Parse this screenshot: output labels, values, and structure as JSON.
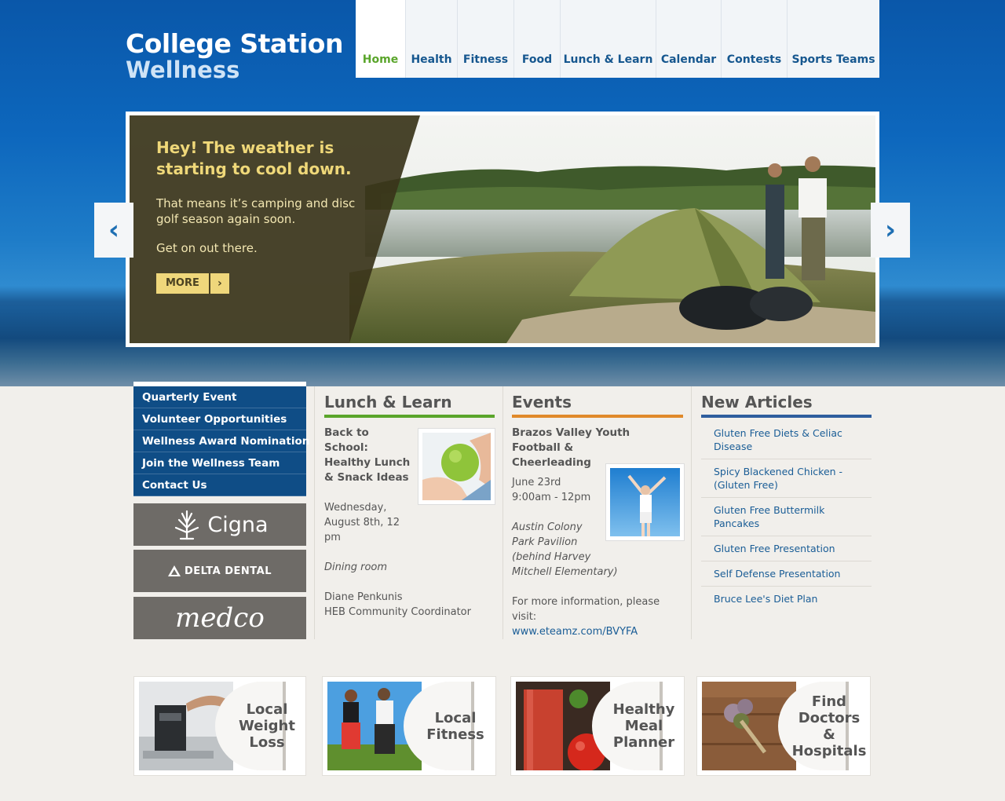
{
  "brand": {
    "line1": "College Station",
    "line2": "Wellness"
  },
  "nav": [
    {
      "label": "Home",
      "active": true
    },
    {
      "label": "Health"
    },
    {
      "label": "Fitness"
    },
    {
      "label": "Food"
    },
    {
      "label": "Lunch & Learn"
    },
    {
      "label": "Calendar"
    },
    {
      "label": "Contests"
    },
    {
      "label": "Sports Teams"
    }
  ],
  "slider": {
    "headline": "Hey! The weather is starting to cool down.",
    "text1": "That means it’s camping and disc golf season again soon.",
    "text2": "Get on out there.",
    "more_label": "MORE",
    "more_arrow": "›",
    "prev_arrow": "‹",
    "next_arrow": "›"
  },
  "side_menu": [
    "Quarterly Event",
    "Volunteer Opportunities",
    "Wellness Award Nomination",
    "Join the Wellness Team",
    "Contact Us"
  ],
  "sponsors": {
    "cigna": "Cigna",
    "delta": "DELTA DENTAL",
    "medco": "medco"
  },
  "lunch_learn": {
    "title": "Lunch & Learn",
    "event_title": "Back to School: Healthy Lunch & Snack Ideas",
    "date": "Wednesday, August 8th, 12 pm",
    "location": "Dining room",
    "presenter": "Diane Penkunis",
    "presenter_role": "HEB Community Coordinator"
  },
  "events": {
    "title": "Events",
    "event_title": "Brazos Valley Youth Football & Cheerleading",
    "date": "June 23rd",
    "time": "9:00am - 12pm",
    "location_1": "Austin Colony",
    "location_2": "Park Pavilion",
    "location_3": "(behind Harvey",
    "location_4": "Mitchell Elementary)",
    "more_info": "For more information, please visit:",
    "link": "www.eteamz.com/BVYFA"
  },
  "articles": {
    "title": "New Articles",
    "items": [
      "Gluten Free Diets & Celiac Disease",
      "Spicy Blackened Chicken -(Gluten Free)",
      "Gluten Free Buttermilk Pancakes",
      "Gluten Free Presentation",
      "Self Defense Presentation",
      "Bruce Lee's Diet Plan"
    ]
  },
  "tiles": [
    {
      "label_1": "Local",
      "label_2": "Weight",
      "label_3": "Loss"
    },
    {
      "label_1": "Local",
      "label_2": "Fitness"
    },
    {
      "label_1": "Healthy",
      "label_2": "Meal",
      "label_3": "Planner"
    },
    {
      "label_1": "Find",
      "label_2": "Doctors &",
      "label_3": "Hospitals"
    }
  ],
  "colors": {
    "nav_text": "#16578f",
    "nav_active": "#5aa52b",
    "menu_bg": "#0f4d86",
    "lunch_underline": "#5aa52b",
    "events_underline": "#e08a2b",
    "articles_underline": "#2f5e9e"
  }
}
